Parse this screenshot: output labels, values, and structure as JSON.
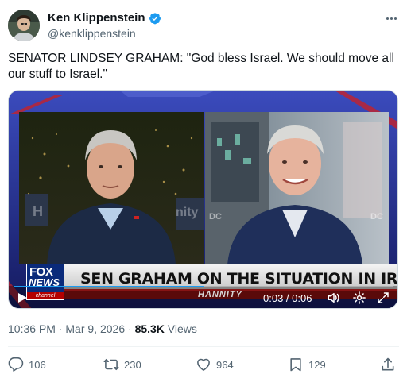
{
  "author": {
    "display_name": "Ken Klippenstein",
    "handle": "@kenklippenstein",
    "verified": true
  },
  "tweet": {
    "text": "SENATOR LINDSEY GRAHAM: \"God bless Israel. We should move all our stuff to Israel.\""
  },
  "video": {
    "chyron": "SEN GRAHAM ON THE SITUATION IN IRAN",
    "show_tag": "HANNITY",
    "logo": {
      "line1": "FOX",
      "line2": "NEWS",
      "line3": "channel"
    },
    "time": "0:03 / 0:06",
    "progress": 0.5
  },
  "meta": {
    "time": "10:36 PM",
    "sep": " · ",
    "date": "Mar 9, 2026",
    "sep2": " · ",
    "views_count": "85.3K",
    "views_label": " Views"
  },
  "actions": {
    "replies": "106",
    "reposts": "230",
    "likes": "964",
    "bookmarks": "129"
  },
  "colors": {
    "accent": "#1d9bf0",
    "text_secondary": "#536471"
  }
}
